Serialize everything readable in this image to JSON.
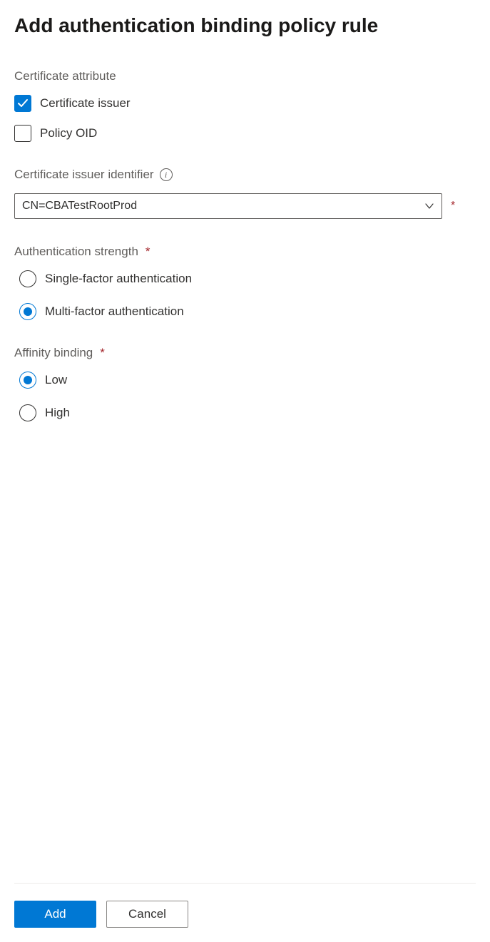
{
  "title": "Add authentication binding policy rule",
  "certificateAttribute": {
    "label": "Certificate attribute",
    "options": [
      {
        "label": "Certificate issuer",
        "checked": true
      },
      {
        "label": "Policy OID",
        "checked": false
      }
    ]
  },
  "issuerIdentifier": {
    "label": "Certificate issuer identifier",
    "required": true,
    "value": "CN=CBATestRootProd"
  },
  "authStrength": {
    "label": "Authentication strength",
    "required": true,
    "options": [
      {
        "label": "Single-factor authentication",
        "selected": false
      },
      {
        "label": "Multi-factor authentication",
        "selected": true
      }
    ]
  },
  "affinityBinding": {
    "label": "Affinity binding",
    "required": true,
    "options": [
      {
        "label": "Low",
        "selected": true
      },
      {
        "label": "High",
        "selected": false
      }
    ]
  },
  "buttons": {
    "add": "Add",
    "cancel": "Cancel"
  },
  "requiredMark": "*",
  "colors": {
    "primary": "#0078d4",
    "text": "#323130",
    "muted": "#605e5c",
    "danger": "#a4262c"
  }
}
